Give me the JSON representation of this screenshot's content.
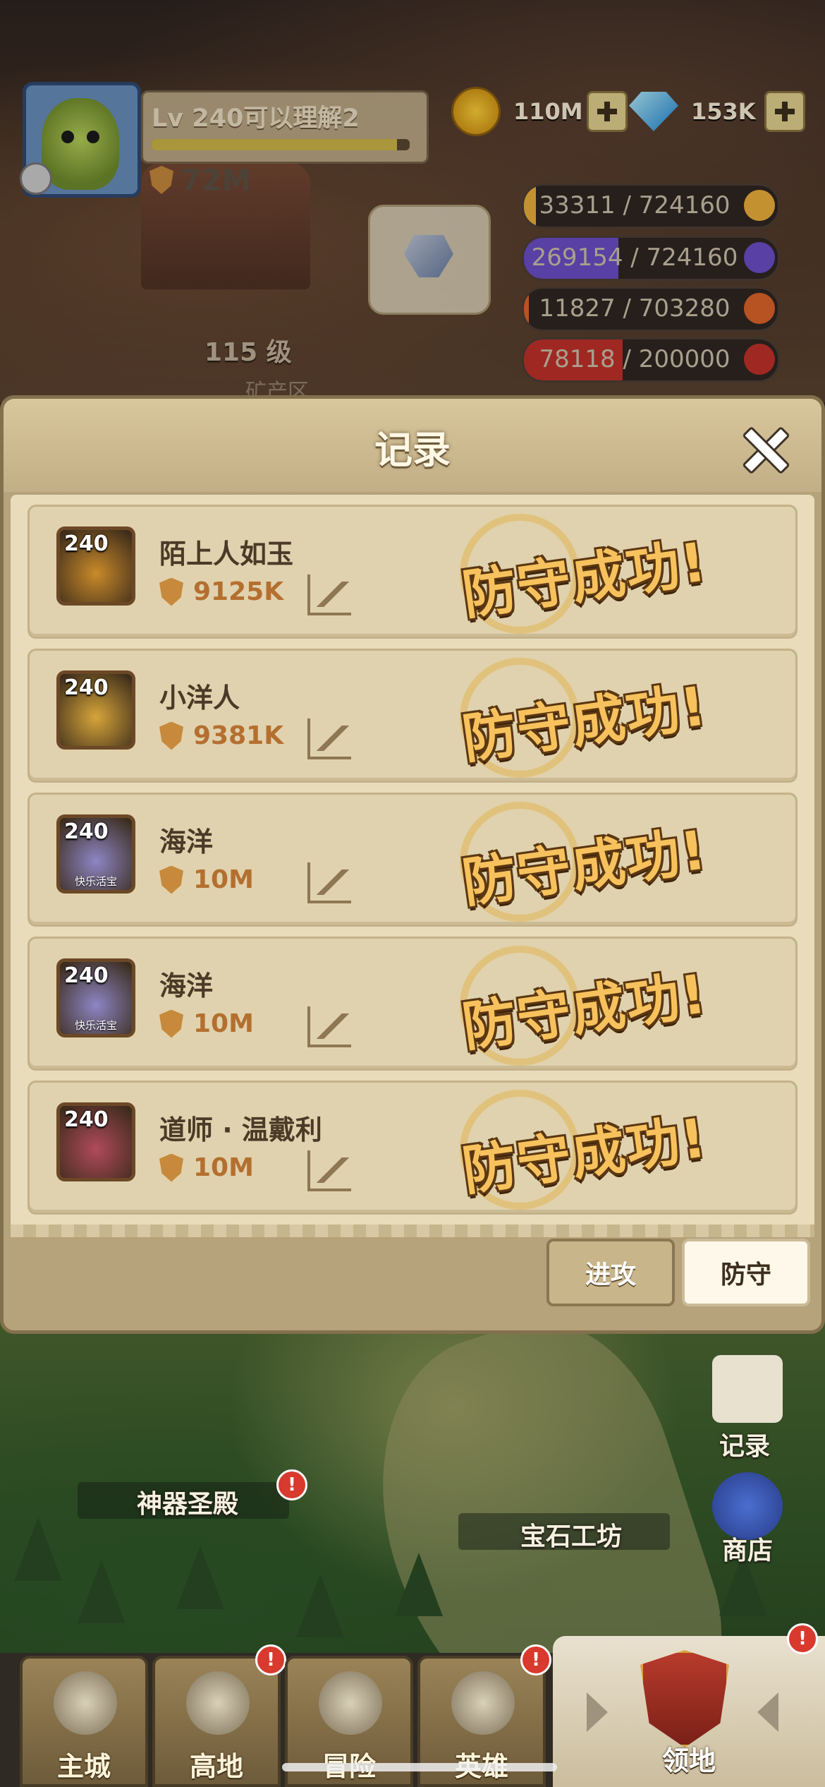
{
  "player": {
    "name": "Lv 240可以理解2",
    "xp_fraction": 0.95,
    "power": "72M"
  },
  "currencies": {
    "coins": "110M",
    "gems": "153K"
  },
  "resources": [
    {
      "text": "33311 / 724160",
      "fraction": 0.046,
      "color": "#f0b13c",
      "icon": "wheat-icon"
    },
    {
      "text": "269154 / 724160",
      "fraction": 0.372,
      "color": "#6c4fc8",
      "icon": "crystal-icon"
    },
    {
      "text": "11827 / 703280",
      "fraction": 0.017,
      "color": "#e0662a",
      "icon": "star-coin-icon"
    },
    {
      "text": "78118 / 200000",
      "fraction": 0.39,
      "color": "#c2332a",
      "icon": "blue-token-icon"
    }
  ],
  "background": {
    "mine_level": "115 级",
    "mine_name": "矿产区"
  },
  "modal": {
    "title": "记录",
    "records": [
      {
        "level": "240",
        "name": "陌上人如玉",
        "power": "9125K",
        "result": "防守成功!",
        "avatar_color": "#c98a2a",
        "tag": ""
      },
      {
        "level": "240",
        "name": "小洋人",
        "power": "9381K",
        "result": "防守成功!",
        "avatar_color": "#d6a53a",
        "tag": ""
      },
      {
        "level": "240",
        "name": "海洋",
        "power": "10M",
        "result": "防守成功!",
        "avatar_color": "#8c86c4",
        "tag": "快乐活宝"
      },
      {
        "level": "240",
        "name": "海洋",
        "power": "10M",
        "result": "防守成功!",
        "avatar_color": "#8c86c4",
        "tag": "快乐活宝"
      },
      {
        "level": "240",
        "name": "道师 · 温戴利",
        "power": "10M",
        "result": "防守成功!",
        "avatar_color": "#b04a5c",
        "tag": ""
      }
    ],
    "tabs": {
      "attack": "进攻",
      "defend": "防守"
    }
  },
  "map": {
    "artifact_hall": "神器圣殿",
    "gem_workshop": "宝石工坊",
    "records_label": "记录",
    "shop_label": "商店",
    "alert": "!"
  },
  "bottom_nav": {
    "main_city": "主城",
    "highland": "高地",
    "adventure": "冒险",
    "heroes": "英雄",
    "territory": "领地"
  }
}
